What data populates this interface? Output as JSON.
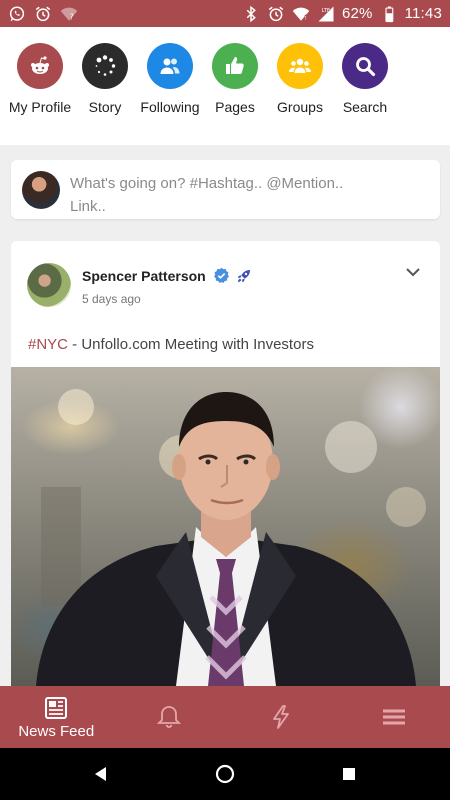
{
  "status_bar": {
    "battery": "62%",
    "time": "11:43",
    "icons": [
      "whatsapp-icon",
      "alarm-icon",
      "wifi-question-icon",
      "bluetooth-icon",
      "alarm-icon",
      "wifi-icon",
      "lte-signal-icon",
      "battery-icon"
    ]
  },
  "shortcuts": [
    {
      "label": "My Profile",
      "icon": "reddit-alien-icon",
      "color": "#a94a4e"
    },
    {
      "label": "Story",
      "icon": "story-spinner-icon",
      "color": "#2b2b2b"
    },
    {
      "label": "Following",
      "icon": "users-icon",
      "color": "#1e88e5"
    },
    {
      "label": "Pages",
      "icon": "thumbs-up-icon",
      "color": "#4caf50"
    },
    {
      "label": "Groups",
      "icon": "group-icon",
      "color": "#ffc107"
    },
    {
      "label": "Search",
      "icon": "search-icon",
      "color": "#4a2a86"
    }
  ],
  "composer": {
    "placeholder": "What's going on? #Hashtag.. @Mention.. Link.."
  },
  "post": {
    "author": "Spencer Patterson",
    "time": "5 days ago",
    "hashtag": "#NYC",
    "text": " - Unfollo.com Meeting with Investors",
    "verified_color": "#4a90e2",
    "rocket_color": "#3f51b5"
  },
  "bottom_nav": {
    "items": [
      {
        "label": "News Feed",
        "icon": "newspaper-icon",
        "active": true
      },
      {
        "label": "",
        "icon": "bell-icon",
        "active": false
      },
      {
        "label": "",
        "icon": "lightning-icon",
        "active": false
      },
      {
        "label": "",
        "icon": "menu-icon",
        "active": false
      }
    ]
  },
  "colors": {
    "brand": "#a94a4e",
    "background": "#efefef"
  }
}
